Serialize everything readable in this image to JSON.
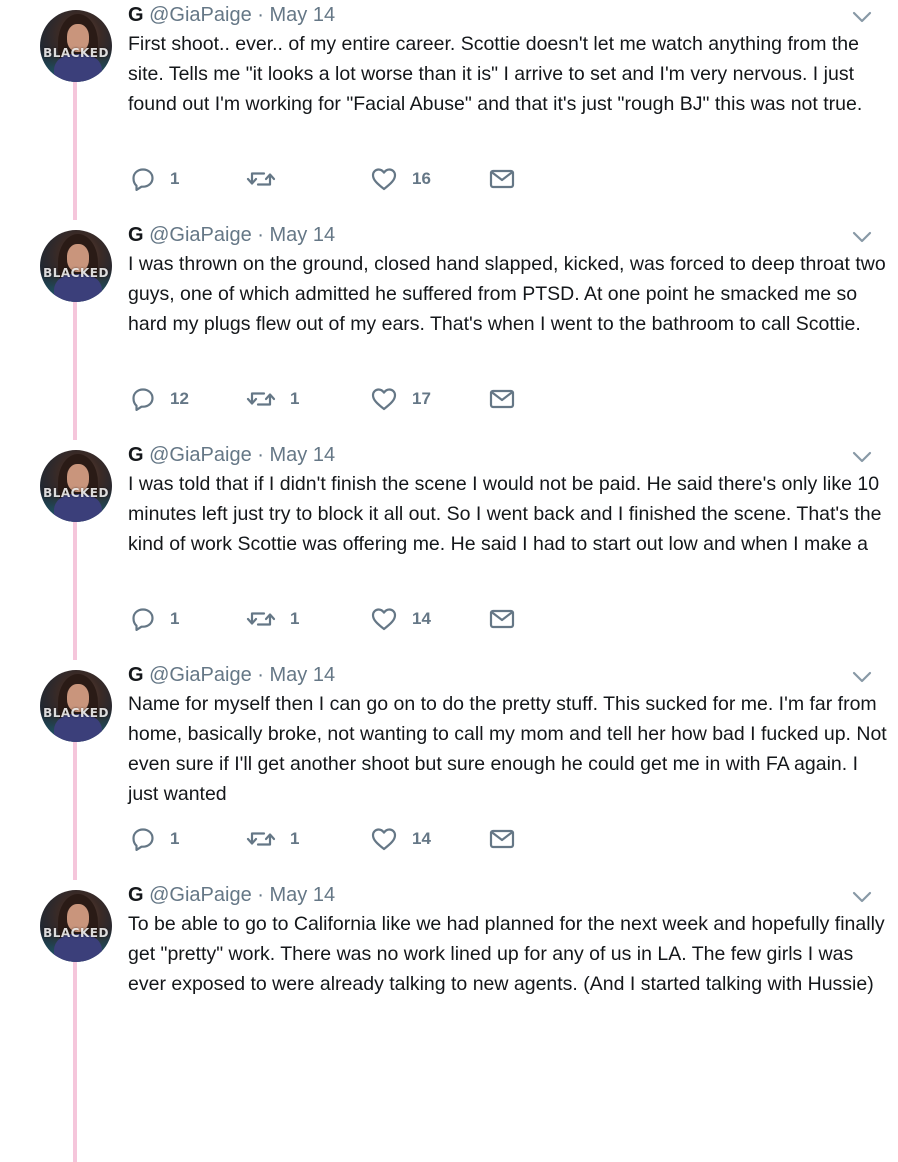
{
  "tweets": [
    {
      "name": "G",
      "handle": "@GiaPaige",
      "separator": "·",
      "date": "May 14",
      "avatar_text": "BLACKED",
      "text": "First shoot.. ever.. of my entire career. Scottie doesn't let me watch anything from the site. Tells me \"it looks a lot worse than it is\" I arrive to set and I'm very nervous. I just found out I'm working for \"Facial Abuse\" and that it's just \"rough BJ\" this was not true.",
      "replies": "1",
      "retweets": "",
      "likes": "16"
    },
    {
      "name": "G",
      "handle": "@GiaPaige",
      "separator": "·",
      "date": "May 14",
      "avatar_text": "BLACKED",
      "text": "I was thrown on the ground, closed hand slapped, kicked, was forced to deep throat two guys, one of which admitted he suffered from PTSD. At one point he smacked me so hard my plugs flew out of my ears. That's when I went to the bathroom to call Scottie.",
      "replies": "12",
      "retweets": "1",
      "likes": "17"
    },
    {
      "name": "G",
      "handle": "@GiaPaige",
      "separator": "·",
      "date": "May 14",
      "avatar_text": "BLACKED",
      "text": "I was told that if I didn't finish the scene I would not be paid. He said there's only like 10 minutes left just try to block it all out. So I went back and I finished the scene. That's the kind of work Scottie was offering me. He said I had to start out low and when I make a",
      "replies": "1",
      "retweets": "1",
      "likes": "14"
    },
    {
      "name": "G",
      "handle": "@GiaPaige",
      "separator": "·",
      "date": "May 14",
      "avatar_text": "BLACKED",
      "text": "Name for myself then I can go on to do the pretty stuff. This sucked for me. I'm far from home, basically broke, not wanting to call my mom and tell her how bad I fucked up. Not even sure if I'll get another shoot but sure enough he could get me in with FA again. I just wanted",
      "replies": "1",
      "retweets": "1",
      "likes": "14"
    },
    {
      "name": "G",
      "handle": "@GiaPaige",
      "separator": "·",
      "date": "May 14",
      "avatar_text": "BLACKED",
      "text": "To be able to go to California like we had planned for the next week and hopefully finally get \"pretty\" work. There was no work lined up for any of us in LA. The few girls I was ever exposed to were already talking to new agents. (And I started talking with Hussie)",
      "replies": "",
      "retweets": "",
      "likes": ""
    }
  ],
  "colors": {
    "text": "#14171a",
    "secondary": "#657786",
    "thread_line": "#f5c6db"
  },
  "icons": [
    "reply-icon",
    "retweet-icon",
    "like-icon",
    "direct-message-icon",
    "chevron-down-icon"
  ]
}
